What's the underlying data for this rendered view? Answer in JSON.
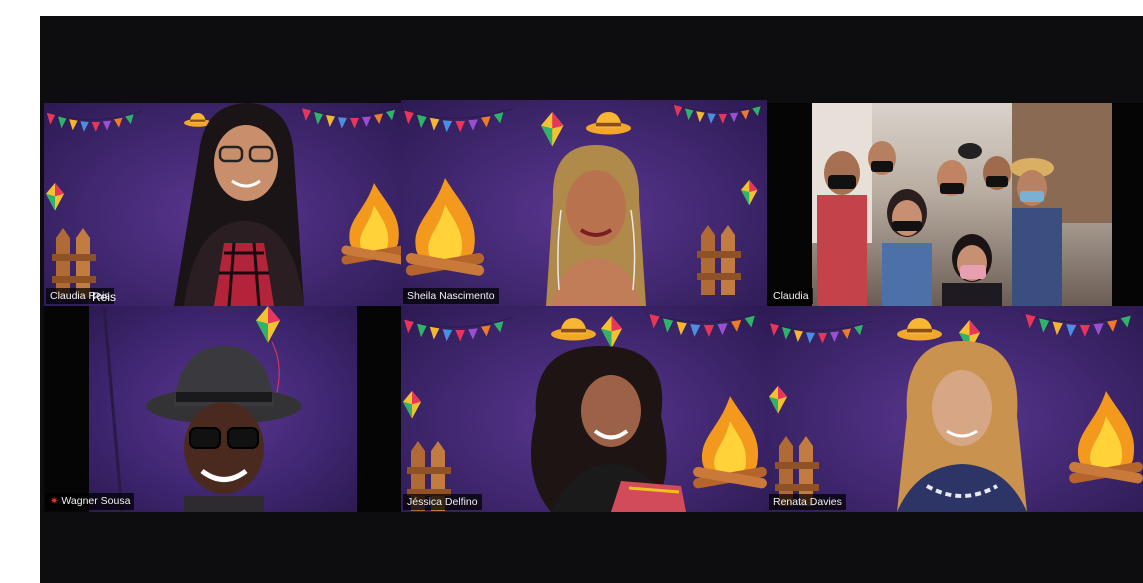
{
  "meeting": {
    "participants": [
      {
        "name": "Claudia Reis",
        "overlay_text": "Reis",
        "active": false
      },
      {
        "name": "Sheila Nascimento",
        "active": true
      },
      {
        "name": "Claudia",
        "active": false
      },
      {
        "name": "Wagner Sousa",
        "muted": true,
        "active": false
      },
      {
        "name": "Jéssica Delfino",
        "active": false
      },
      {
        "name": "Renata Davies",
        "active": false
      }
    ]
  },
  "icons": {
    "muted": "mic-muted-icon"
  },
  "colors": {
    "background": "#0d0d0f",
    "tile_purple": "#40276f",
    "active_border": "#d9df94",
    "muted_mic": "#e0362c"
  }
}
